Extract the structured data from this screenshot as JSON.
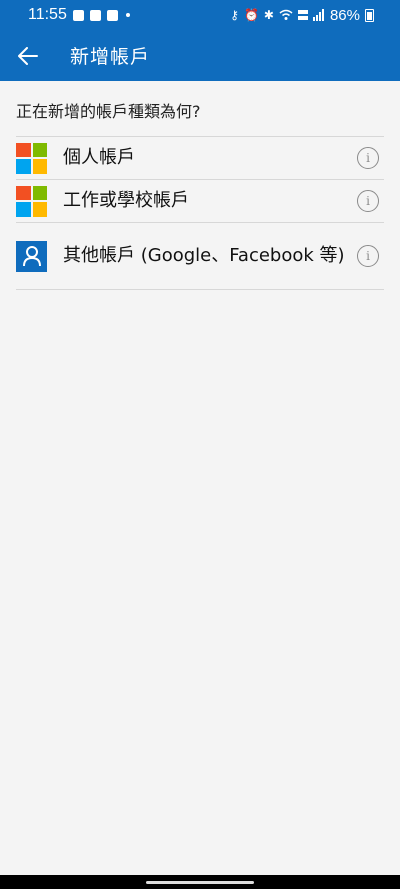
{
  "status_bar": {
    "time": "11:55",
    "battery": "86%",
    "icons": [
      "image-icon",
      "teams-icon",
      "teams-icon",
      "notification-dot-icon",
      "key-icon",
      "alarm-icon",
      "bluetooth-icon",
      "wifi-icon",
      "volte-icon",
      "signal-icon",
      "battery-icon"
    ]
  },
  "app_bar": {
    "title": "新增帳戶",
    "back_icon": "arrow-left-icon"
  },
  "question": "正在新增的帳戶種類為何?",
  "accounts": [
    {
      "label": "個人帳戶",
      "icon": "microsoft-logo-icon"
    },
    {
      "label": "工作或學校帳戶",
      "icon": "microsoft-logo-icon"
    },
    {
      "label": "其他帳戶 (Google、Facebook 等)",
      "icon": "person-icon"
    }
  ],
  "colors": {
    "brand": "#0f6cbd",
    "ms_red": "#f25022",
    "ms_green": "#7fba00",
    "ms_blue": "#00a4ef",
    "ms_yellow": "#ffb900"
  }
}
